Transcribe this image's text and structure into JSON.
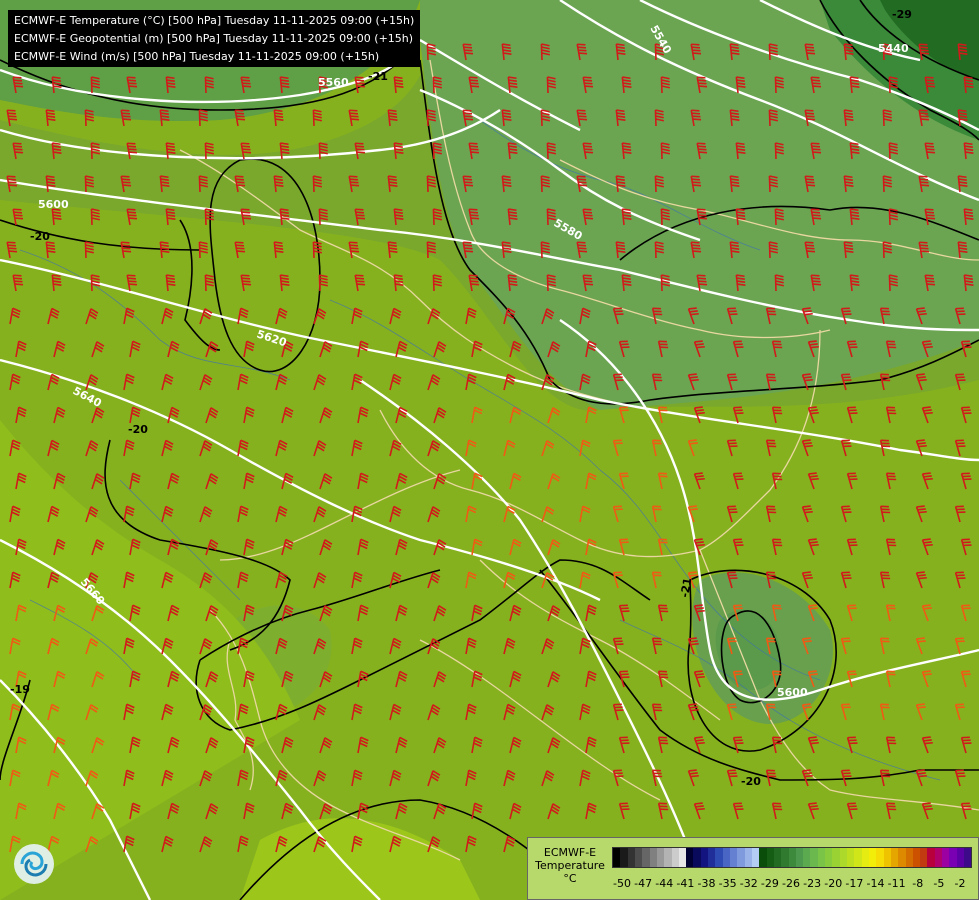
{
  "titles": [
    "ECMWF-E Temperature (°C) [500 hPa] Tuesday 11-11-2025 09:00 (+15h)",
    "ECMWF-E Geopotential (m) [500 hPa] Tuesday 11-11-2025 09:00 (+15h)",
    "ECMWF-E Wind (m/s) [500 hPa] Tuesday 11-11-2025 09:00 (+15h)"
  ],
  "contour_labels": {
    "geopotential": [
      "5440",
      "5480",
      "5540",
      "5560",
      "5580",
      "5600",
      "5620",
      "5640",
      "5660"
    ],
    "temperature": [
      "-29",
      "-21",
      "-20",
      "-19",
      "-20",
      "-21",
      "-20",
      "-19"
    ]
  },
  "legend": {
    "title_line1": "ECMWF-E",
    "title_line2": "Temperature",
    "unit": "°C",
    "ticks": [
      "-50",
      "-47",
      "-44",
      "-41",
      "-38",
      "-35",
      "-32",
      "-29",
      "-26",
      "-23",
      "-20",
      "-17",
      "-14",
      "-11",
      "-8",
      "-5",
      "-2"
    ],
    "colors": [
      "#000000",
      "#1a1a1a",
      "#333333",
      "#4d4d4d",
      "#666666",
      "#808080",
      "#999999",
      "#b3b3b3",
      "#cccccc",
      "#e6e6e6",
      "#000033",
      "#0a0a5c",
      "#141480",
      "#1f2e99",
      "#2e4ab3",
      "#4a66c4",
      "#6680d1",
      "#809ade",
      "#9ab4ea",
      "#b3cdf5",
      "#0a4d0a",
      "#155c15",
      "#226b22",
      "#2f7a2f",
      "#3d8a3d",
      "#4d994d",
      "#5caa4f",
      "#6bb84f",
      "#7ac448",
      "#88cc3d",
      "#9ad133",
      "#acd92a",
      "#bedf20",
      "#d1e619",
      "#e4ec12",
      "#f2ee0a",
      "#f5dd05",
      "#f0c300",
      "#e6a600",
      "#dd8a00",
      "#d46e00",
      "#cc5200",
      "#c23a10",
      "#b8003d",
      "#b0006b",
      "#9c00a3",
      "#7a00b3",
      "#5c00a6",
      "#3d0a8a"
    ]
  },
  "colors": {
    "lowland": "#8ab825",
    "mid": "#74a530",
    "cold": "#4d8f4a",
    "coldest": "#2f7a2f",
    "wind_barb": "#d11a1a",
    "wind_barb_warm": "#f05a14",
    "isohypse": "#ffffff",
    "isotherm": "#000000",
    "border": "#e8d7a0",
    "river": "#3d6fb3"
  },
  "icons": [
    "ecmwf-logo-icon"
  ]
}
